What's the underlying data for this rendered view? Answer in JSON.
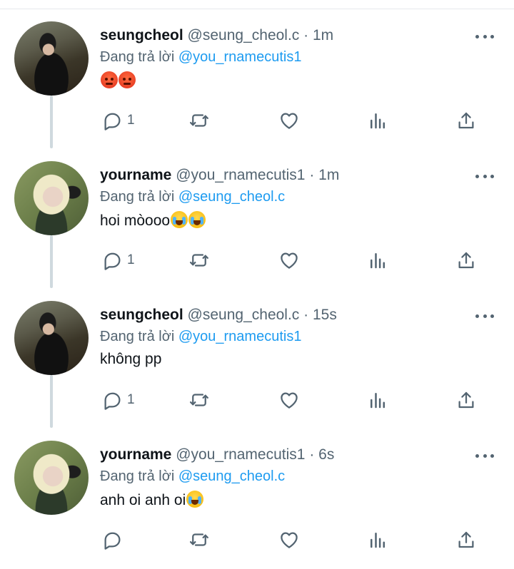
{
  "tweets": [
    {
      "name": "seungcheol",
      "handle": "@seung_cheol.c",
      "time": "1m",
      "reply_prefix": "Đang trả lời",
      "reply_to": "@you_rnamecutis1",
      "text": "",
      "emojis": [
        "angry-face",
        "angry-face"
      ],
      "reply_count": "1"
    },
    {
      "name": "yourname",
      "handle": "@you_rnamecutis1",
      "time": "1m",
      "reply_prefix": "Đang trả lời",
      "reply_to": "@seung_cheol.c",
      "text": "hoi mòooo",
      "emojis": [
        "crying-face",
        "crying-face"
      ],
      "reply_count": "1"
    },
    {
      "name": "seungcheol",
      "handle": "@seung_cheol.c",
      "time": "15s",
      "reply_prefix": "Đang trả lời",
      "reply_to": "@you_rnamecutis1",
      "text": "không pp",
      "emojis": [],
      "reply_count": "1"
    },
    {
      "name": "yourname",
      "handle": "@you_rnamecutis1",
      "time": "6s",
      "reply_prefix": "Đang trả lời",
      "reply_to": "@seung_cheol.c",
      "text": "anh oi anh oi",
      "emojis": [
        "crying-face"
      ],
      "reply_count": ""
    }
  ],
  "separator": "·",
  "colors": {
    "text": "#0f1419",
    "muted": "#536471",
    "link": "#1d9bf0",
    "thread": "#cfd9de"
  },
  "icons": [
    "reply-icon",
    "retweet-icon",
    "like-icon",
    "stats-icon",
    "share-icon",
    "more-icon"
  ]
}
